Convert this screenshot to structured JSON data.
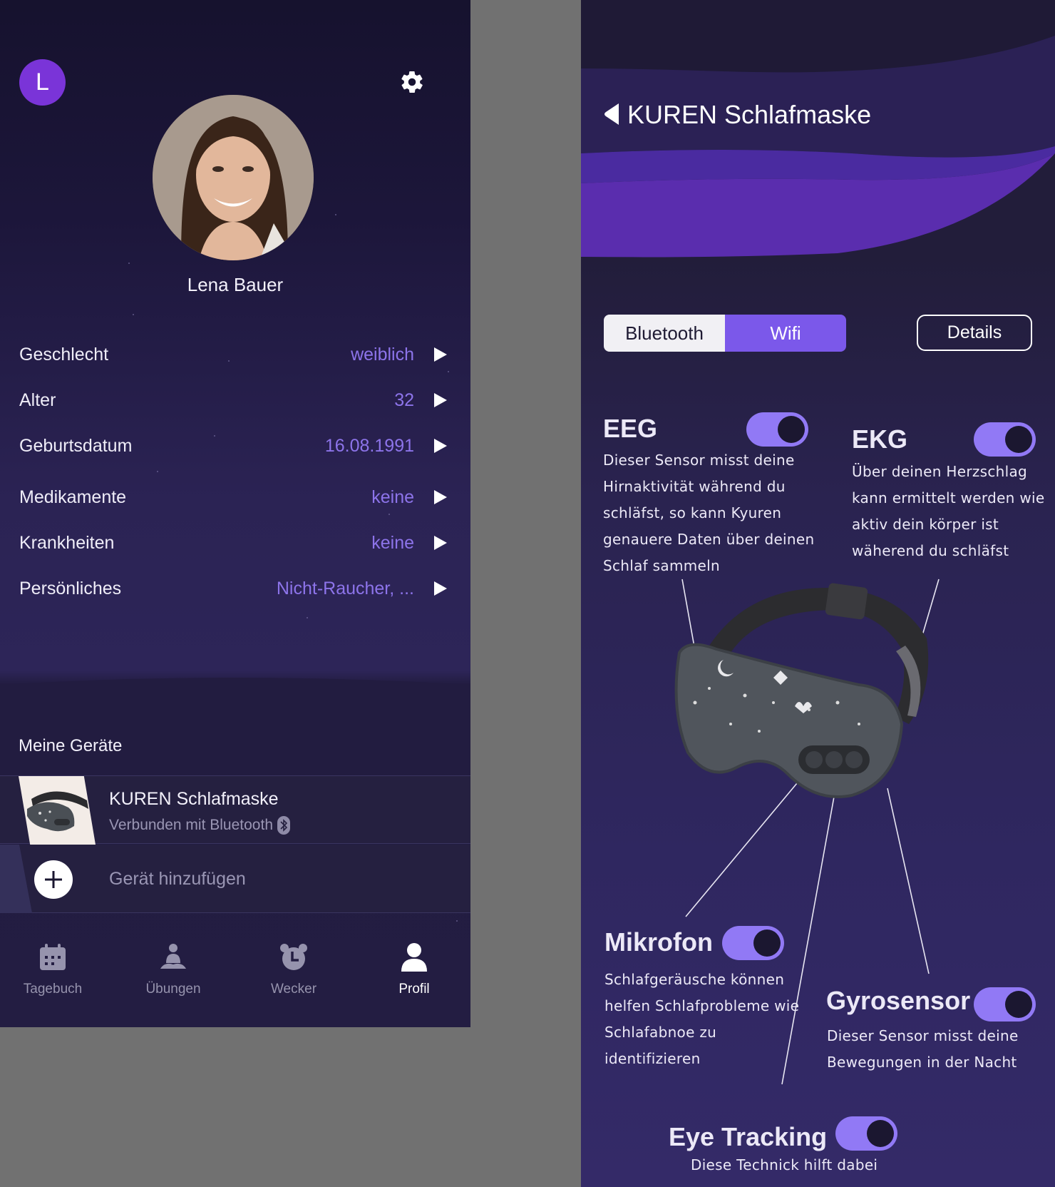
{
  "left": {
    "avatar_initial": "L",
    "profile_name": "Lena Bauer",
    "info_rows": [
      {
        "label": "Geschlecht",
        "value": "weiblich"
      },
      {
        "label": "Alter",
        "value": "32"
      },
      {
        "label": "Geburtsdatum",
        "value": "16.08.1991"
      },
      {
        "label": "Medikamente",
        "value": "keine"
      },
      {
        "label": "Krankheiten",
        "value": "keine"
      },
      {
        "label": "Persönliches",
        "value": "Nicht-Raucher, ..."
      }
    ],
    "devices_title": "Meine Geräte",
    "device": {
      "name": "KUREN Schlafmaske",
      "status": "Verbunden mit Bluetooth"
    },
    "add_device_label": "Gerät hinzufügen",
    "tabs": [
      {
        "label": "Tagebuch",
        "icon": "calendar-icon"
      },
      {
        "label": "Übungen",
        "icon": "meditation-icon"
      },
      {
        "label": "Wecker",
        "icon": "alarm-clock-icon"
      },
      {
        "label": "Profil",
        "icon": "user-icon"
      }
    ],
    "active_tab": "Profil"
  },
  "right": {
    "title": "KUREN Schlafmaske",
    "segments": [
      "Bluetooth",
      "Wifi"
    ],
    "selected_segment": "Wifi",
    "details_label": "Details",
    "features": [
      {
        "title": "EEG",
        "enabled": true,
        "desc": [
          "Dieser Sensor misst deine",
          "Hirnaktivität während du",
          "schläfst, so kann Kyuren",
          "genauere Daten über deinen",
          "Schlaf sammeln"
        ]
      },
      {
        "title": "EKG",
        "enabled": true,
        "desc": [
          "Über deinen Herzschlag",
          "kann ermittelt werden wie",
          "aktiv dein körper ist",
          "wäherend du schläfst"
        ]
      },
      {
        "title": "Mikrofon",
        "enabled": true,
        "desc": [
          "Schlafgeräusche können",
          "helfen Schlafprobleme wie",
          "Schlafabnoe zu",
          "identifizieren"
        ]
      },
      {
        "title": "Gyrosensor",
        "enabled": true,
        "desc": [
          "Dieser Sensor misst deine",
          "Bewegungen in der Nacht"
        ]
      },
      {
        "title": "Eye Tracking",
        "enabled": true,
        "desc": [
          "Diese Technick hilft dabei"
        ]
      }
    ]
  },
  "colors": {
    "accent": "#7b58ea",
    "value_text": "#8d74ea",
    "toggle_on": "#9179f5",
    "avatar": "#7a34d8"
  }
}
